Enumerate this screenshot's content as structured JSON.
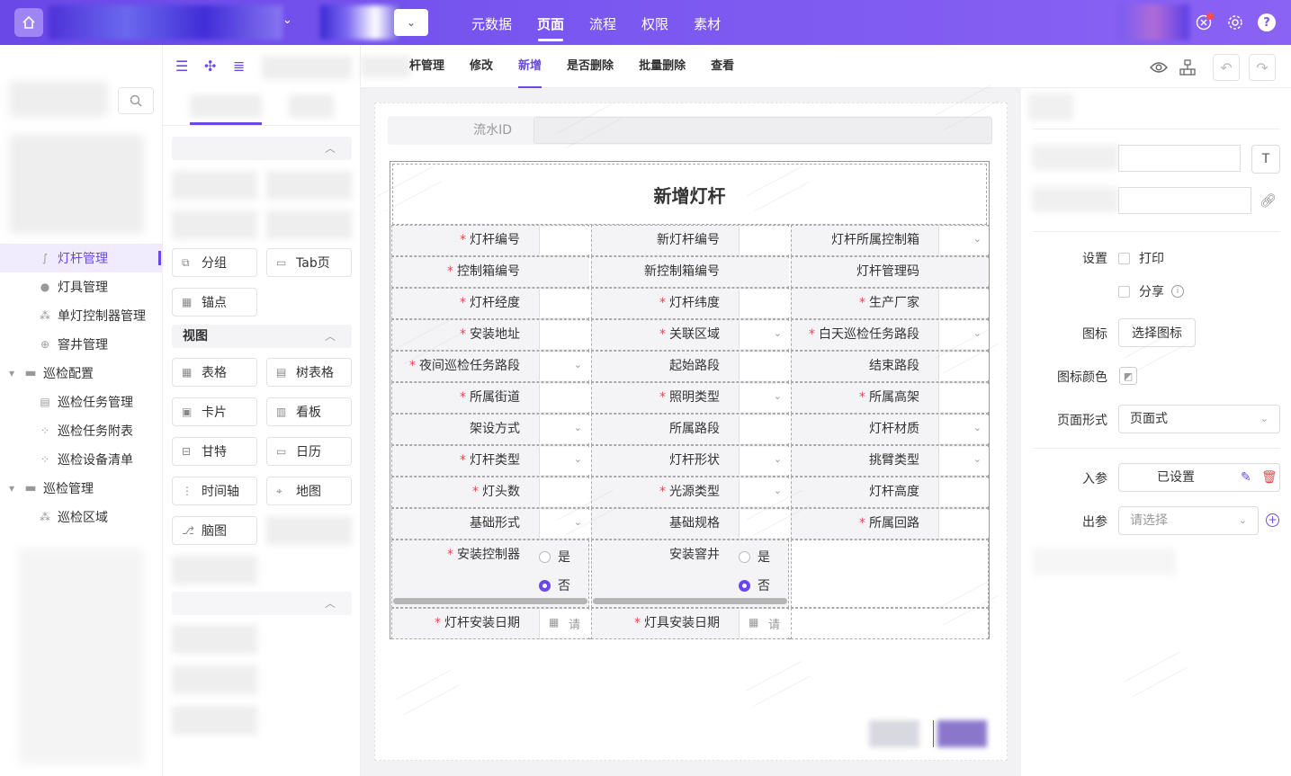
{
  "topbar": {
    "nav": [
      "元数据",
      "页面",
      "流程",
      "权限",
      "素材"
    ],
    "active_index": 1
  },
  "sidebar": {
    "items": [
      {
        "label": "灯杆管理",
        "icon": "pole-icon",
        "active": true
      },
      {
        "label": "灯具管理",
        "icon": "lamp-icon"
      },
      {
        "label": "单灯控制器管理",
        "icon": "controller-icon"
      },
      {
        "label": "窨井管理",
        "icon": "add-circle-icon"
      },
      {
        "label": "巡检配置",
        "icon": "folder-icon",
        "group": true
      },
      {
        "label": "巡检任务管理",
        "icon": "doc-icon"
      },
      {
        "label": "巡检任务附表",
        "icon": "grid-icon"
      },
      {
        "label": "巡检设备清单",
        "icon": "grid-icon"
      },
      {
        "label": "巡检管理",
        "icon": "folder-icon",
        "group": true
      },
      {
        "label": "巡检区域",
        "icon": "region-icon"
      }
    ]
  },
  "components": {
    "layout_buttons": [
      "分组",
      "Tab页",
      "锚点"
    ],
    "view_section": "视图",
    "view_buttons": [
      "表格",
      "树表格",
      "卡片",
      "看板",
      "甘特",
      "日历",
      "时间轴",
      "地图",
      "脑图"
    ]
  },
  "editor": {
    "tabs": [
      "杆管理",
      "修改",
      "新增",
      "是否删除",
      "批量删除",
      "查看"
    ],
    "active_tab_index": 2
  },
  "form": {
    "flow_label": "流水ID",
    "title": "新增灯杆",
    "rows": [
      [
        {
          "label": "灯杆编号",
          "req": true
        },
        {
          "label": "新灯杆编号"
        },
        {
          "label": "灯杆所属控制箱",
          "dd": true
        }
      ],
      [
        {
          "label": "控制箱编号",
          "req": true,
          "ro": true
        },
        {
          "label": "新控制箱编号",
          "ro": true
        },
        {
          "label": "灯杆管理码",
          "ro": true
        }
      ],
      [
        {
          "label": "灯杆经度",
          "req": true
        },
        {
          "label": "灯杆纬度",
          "req": true
        },
        {
          "label": "生产厂家",
          "req": true
        }
      ],
      [
        {
          "label": "安装地址",
          "req": true
        },
        {
          "label": "关联区域",
          "req": true,
          "dd": true
        },
        {
          "label": "白天巡检任务路段",
          "req": true,
          "dd": true
        }
      ],
      [
        {
          "label": "夜间巡检任务路段",
          "req": true,
          "dd": true
        },
        {
          "label": "起始路段"
        },
        {
          "label": "结束路段"
        }
      ],
      [
        {
          "label": "所属街道",
          "req": true
        },
        {
          "label": "照明类型",
          "req": true,
          "dd": true
        },
        {
          "label": "所属高架",
          "req": true
        }
      ],
      [
        {
          "label": "架设方式",
          "dd": true
        },
        {
          "label": "所属路段"
        },
        {
          "label": "灯杆材质",
          "dd": true
        }
      ],
      [
        {
          "label": "灯杆类型",
          "req": true,
          "dd": true
        },
        {
          "label": "灯杆形状",
          "dd": true
        },
        {
          "label": "挑臂类型",
          "dd": true
        }
      ],
      [
        {
          "label": "灯头数",
          "req": true
        },
        {
          "label": "光源类型",
          "req": true,
          "dd": true
        },
        {
          "label": "灯杆高度"
        }
      ],
      [
        {
          "label": "基础形式",
          "dd": true
        },
        {
          "label": "基础规格"
        },
        {
          "label": "所属回路",
          "req": true
        }
      ]
    ],
    "radio_row": [
      {
        "label": "安装控制器",
        "req": true,
        "yes": "是",
        "no": "否",
        "selected": "否"
      },
      {
        "label": "安装窨井",
        "req": false,
        "yes": "是",
        "no": "否",
        "selected": "否"
      }
    ],
    "date_row": [
      {
        "label": "灯杆安装日期",
        "req": true,
        "placeholder": "请"
      },
      {
        "label": "灯具安装日期",
        "req": true,
        "placeholder": "请"
      }
    ]
  },
  "right_panel": {
    "settings_label": "设置",
    "print_label": "打印",
    "share_label": "分享",
    "icon_label": "图标",
    "choose_icon_button": "选择图标",
    "icon_color_label": "图标颜色",
    "page_form_label": "页面形式",
    "page_form_value": "页面式",
    "in_param_label": "入参",
    "in_param_value": "已设置",
    "out_param_label": "出参",
    "out_param_placeholder": "请选择",
    "t_button": "T"
  },
  "colors": {
    "accent": "#6a48e8",
    "required": "#e5484d",
    "delete": "#e5484d"
  }
}
